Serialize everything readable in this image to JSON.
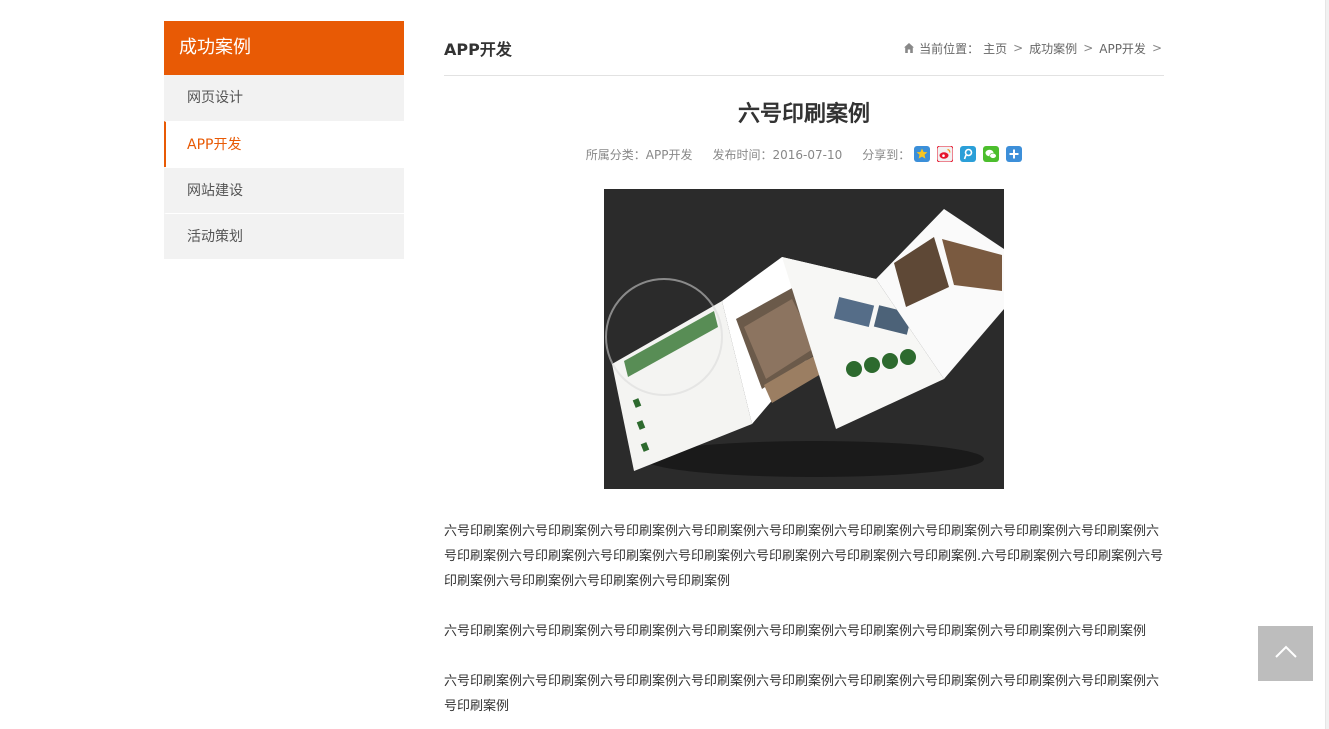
{
  "sidebar": {
    "title": "成功案例",
    "items": [
      {
        "label": "网页设计"
      },
      {
        "label": "APP开发"
      },
      {
        "label": "网站建设"
      },
      {
        "label": "活动策划"
      }
    ]
  },
  "main": {
    "section_title": "APP开发",
    "breadcrumb": {
      "prefix": "当前位置：",
      "items": [
        "主页",
        "成功案例",
        "APP开发"
      ],
      "separator": ">"
    }
  },
  "article": {
    "title": "六号印刷案例",
    "category_label": "所属分类：",
    "category_value": "APP开发",
    "date_label": "发布时间：",
    "date_value": "2016-07-10",
    "share_label": "分享到：",
    "share_icons": [
      "qzone-icon",
      "weibo-icon",
      "tencent-weibo-icon",
      "wechat-icon",
      "more-share-icon"
    ],
    "paragraphs": [
      "六号印刷案例六号印刷案例六号印刷案例六号印刷案例六号印刷案例六号印刷案例六号印刷案例六号印刷案例六号印刷案例六号印刷案例六号印刷案例六号印刷案例六号印刷案例六号印刷案例六号印刷案例六号印刷案例.六号印刷案例六号印刷案例六号印刷案例六号印刷案例六号印刷案例六号印刷案例",
      "六号印刷案例六号印刷案例六号印刷案例六号印刷案例六号印刷案例六号印刷案例六号印刷案例六号印刷案例六号印刷案例",
      "六号印刷案例六号印刷案例六号印刷案例六号印刷案例六号印刷案例六号印刷案例六号印刷案例六号印刷案例六号印刷案例六号印刷案例"
    ]
  },
  "colors": {
    "accent": "#e85a05",
    "sidebar_bg": "#f2f2f2",
    "back_top_bg": "#bdbdbd"
  }
}
